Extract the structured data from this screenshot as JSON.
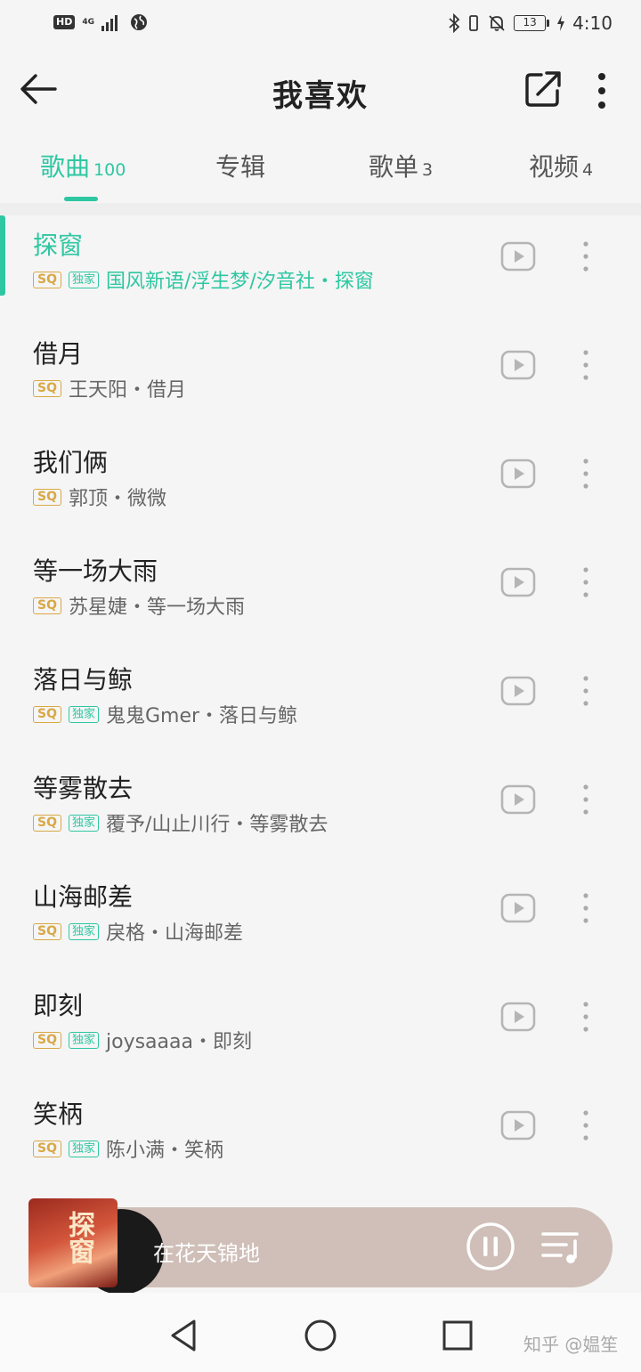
{
  "status_bar": {
    "hd": "HD",
    "network": "4G",
    "battery": "13",
    "time": "4:10"
  },
  "header": {
    "title": "我喜欢"
  },
  "tabs": [
    {
      "label": "歌曲",
      "count": "100"
    },
    {
      "label": "专辑",
      "count": ""
    },
    {
      "label": "歌单",
      "count": "3"
    },
    {
      "label": "视频",
      "count": "4"
    }
  ],
  "tags": {
    "sq": "SQ",
    "exclusive": "独家"
  },
  "songs": [
    {
      "title": "探窗",
      "artist": "国风新语/浮生梦/汐音社・探窗",
      "exclusive": true,
      "playing": true
    },
    {
      "title": "借月",
      "artist": "王天阳・借月",
      "exclusive": false,
      "playing": false
    },
    {
      "title": "我们俩",
      "artist": "郭顶・微微",
      "exclusive": false,
      "playing": false
    },
    {
      "title": "等一场大雨",
      "artist": "苏星婕・等一场大雨",
      "exclusive": false,
      "playing": false
    },
    {
      "title": "落日与鲸",
      "artist": "鬼鬼Gmer・落日与鲸",
      "exclusive": true,
      "playing": false
    },
    {
      "title": "等雾散去",
      "artist": "覆予/山止川行・等雾散去",
      "exclusive": true,
      "playing": false
    },
    {
      "title": "山海邮差",
      "artist": "戾格・山海邮差",
      "exclusive": true,
      "playing": false
    },
    {
      "title": "即刻",
      "artist": "joysaaaa・即刻",
      "exclusive": true,
      "playing": false
    },
    {
      "title": "笑柄",
      "artist": "陈小满・笑柄",
      "exclusive": true,
      "playing": false
    }
  ],
  "player": {
    "current_song": "在花天锦地",
    "cover_text": "探窗"
  },
  "watermark": "知乎 @媪笙",
  "colors": {
    "accent": "#2ec7a2",
    "sq_tag": "#d9a845",
    "player_bg": "#cfbfb8"
  }
}
